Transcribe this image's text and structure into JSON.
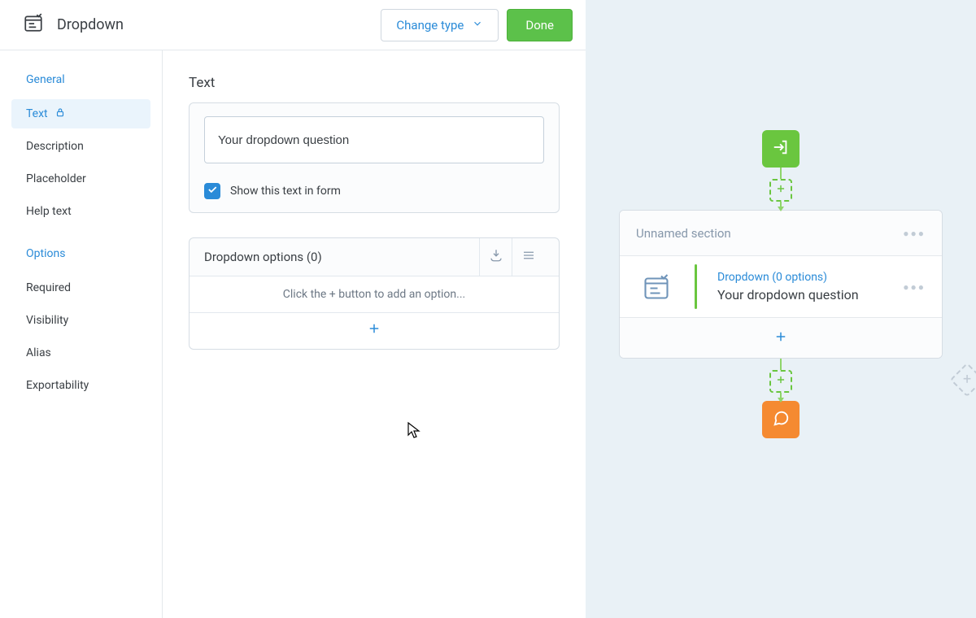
{
  "header": {
    "title": "Dropdown",
    "change_type_label": "Change type",
    "done_label": "Done"
  },
  "sidebar": {
    "section_general": "General",
    "section_options": "Options",
    "items_general": [
      {
        "label": "Text",
        "active": true,
        "locked": true
      },
      {
        "label": "Description"
      },
      {
        "label": "Placeholder"
      },
      {
        "label": "Help text"
      }
    ],
    "items_options": [
      {
        "label": "Required"
      },
      {
        "label": "Visibility"
      },
      {
        "label": "Alias"
      },
      {
        "label": "Exportability"
      }
    ]
  },
  "main": {
    "section_label": "Text",
    "field_value": "Your dropdown question",
    "show_in_form_label": "Show this text in form",
    "options_header": "Dropdown options (0)",
    "options_placeholder": "Click the + button to add an option..."
  },
  "preview": {
    "section_title": "Unnamed section",
    "card_meta": "Dropdown (0 options)",
    "card_label": "Your dropdown question"
  },
  "colors": {
    "primary_blue": "#2a8bd8",
    "accent_green": "#6ac63f",
    "done_green": "#5cc14a",
    "node_orange": "#f58a31",
    "text": "#3a3f44",
    "muted": "#8798ab"
  }
}
